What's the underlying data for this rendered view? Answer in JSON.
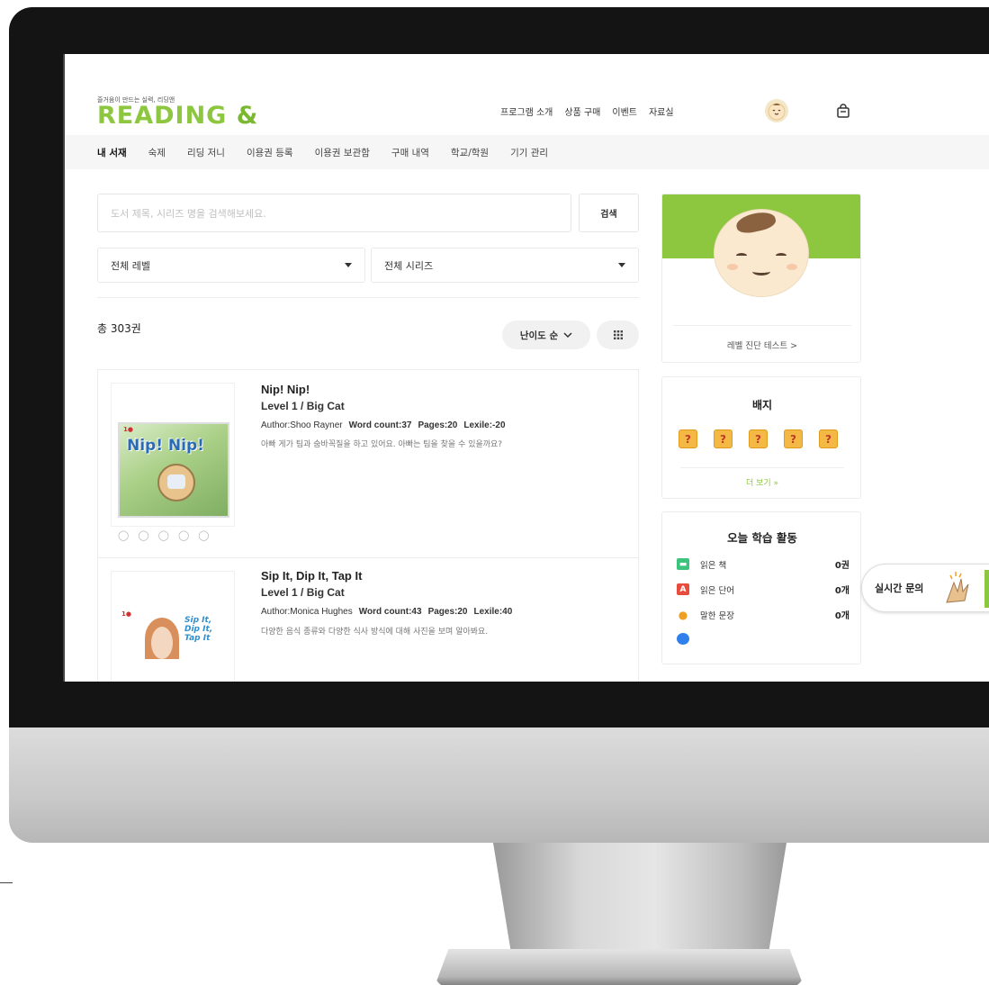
{
  "header": {
    "logo_tagline": "즐거움이 만드는 실력, 리딩앤",
    "logo_text": "READING",
    "logo_amp": "&",
    "nav": [
      "프로그램 소개",
      "상품 구매",
      "이벤트",
      "자료실"
    ],
    "avatar_icon": "baby-face-icon",
    "bag_icon": "shopping-bag-icon"
  },
  "subnav": {
    "items": [
      "내 서재",
      "숙제",
      "리딩 저니",
      "이용권 등록",
      "이용권 보관함",
      "구매 내역",
      "학교/학원",
      "기기 관리"
    ],
    "active": "내 서재"
  },
  "search": {
    "placeholder": "도서 제목, 시리즈 명을 검색해보세요.",
    "button": "검색"
  },
  "filters": {
    "level": "전체 레벨",
    "series": "전체 시리즈"
  },
  "list": {
    "total": "총 303권",
    "sort": "난이도 순",
    "sort_icon": "chevron-down-icon",
    "view_icon": "grid-icon"
  },
  "books": [
    {
      "title": "Nip! Nip!",
      "level": "Level 1 / Big Cat",
      "author": "Author:Shoo Rayner",
      "word_count": "Word count:37",
      "pages": "Pages:20",
      "lexile": "Lexile:-20",
      "description": "아빠 게가 팀과 숨바꼭질을 하고 있어요. 아빠는 팀을 찾을 수 있을까요?",
      "cover_title": "Nip! Nip!"
    },
    {
      "title": "Sip It, Dip It, Tap It",
      "level": "Level 1 / Big Cat",
      "author": "Author:Monica Hughes",
      "word_count": "Word count:43",
      "pages": "Pages:20",
      "lexile": "Lexile:40",
      "description": "다양한 음식 종류와 다양한 식사 방식에 대해 사진을 보며 알아봐요.",
      "cover_title": "Sip It, Dip It, Tap It"
    }
  ],
  "profile": {
    "level_test": "레벨 진단 테스트 >"
  },
  "badges": {
    "title": "배지",
    "items": [
      "?",
      "?",
      "?",
      "?",
      "?"
    ],
    "more": "더 보기 »"
  },
  "activity": {
    "title": "오늘 학습 활동",
    "rows": [
      {
        "label": "읽은 책",
        "value": "0권",
        "icon": "book-icon",
        "color": "#3cc47c"
      },
      {
        "label": "읽은 단어",
        "value": "0개",
        "icon": "letter-a-icon",
        "color": "#e74c3c"
      },
      {
        "label": "말한 문장",
        "value": "0개",
        "icon": "microphone-icon",
        "color": "#f0a020"
      }
    ]
  },
  "live_chat": {
    "label": "실시간 문의"
  },
  "colors": {
    "brand_green": "#8dc63f"
  }
}
